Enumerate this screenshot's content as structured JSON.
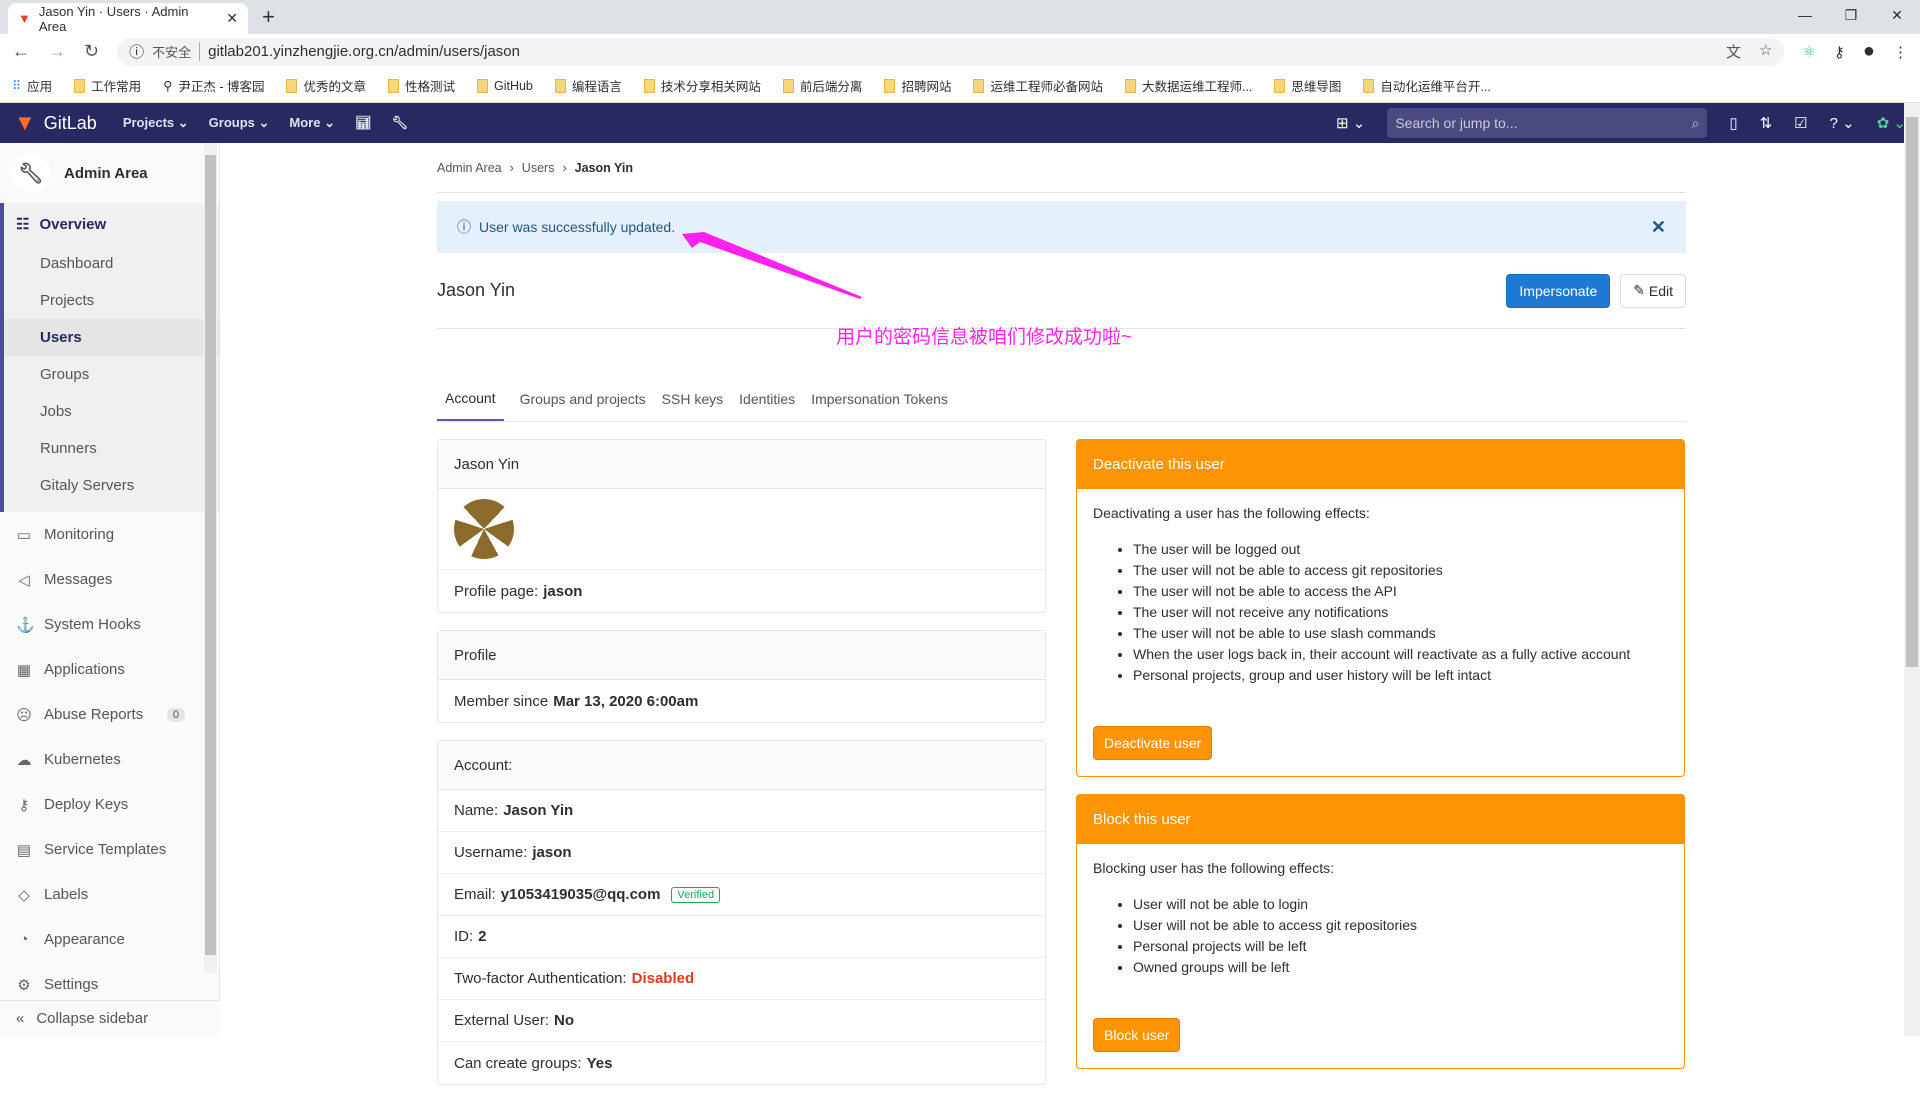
{
  "browser": {
    "tab_title": "Jason Yin · Users · Admin Area",
    "security": "不安全",
    "url": "gitlab201.yinzhengjie.org.cn/admin/users/jason",
    "bookmarks": [
      "应用",
      "工作常用",
      "尹正杰 - 博客园",
      "优秀的文章",
      "性格测试",
      "GitHub",
      "编程语言",
      "技术分享相关网站",
      "前后端分离",
      "招聘网站",
      "运维工程师必备网站",
      "大数据运维工程师...",
      "思维导图",
      "自动化运维平台开..."
    ]
  },
  "navbar": {
    "brand": "GitLab",
    "menus": [
      "Projects",
      "Groups",
      "More"
    ],
    "search_placeholder": "Search or jump to..."
  },
  "sidebar": {
    "title": "Admin Area",
    "overview": "Overview",
    "sub": [
      "Dashboard",
      "Projects",
      "Users",
      "Groups",
      "Jobs",
      "Runners",
      "Gitaly Servers"
    ],
    "items": [
      {
        "label": "Monitoring",
        "icon": "monitor-icon"
      },
      {
        "label": "Messages",
        "icon": "megaphone-icon"
      },
      {
        "label": "System Hooks",
        "icon": "hook-icon"
      },
      {
        "label": "Applications",
        "icon": "grid-icon"
      },
      {
        "label": "Abuse Reports",
        "icon": "sad-face-icon",
        "badge": "0"
      },
      {
        "label": "Kubernetes",
        "icon": "kubernetes-icon"
      },
      {
        "label": "Deploy Keys",
        "icon": "key-icon"
      },
      {
        "label": "Service Templates",
        "icon": "template-icon"
      },
      {
        "label": "Labels",
        "icon": "label-icon"
      },
      {
        "label": "Appearance",
        "icon": "palette-icon"
      },
      {
        "label": "Settings",
        "icon": "gear-icon"
      }
    ],
    "collapse": "Collapse sidebar"
  },
  "breadcrumb": [
    "Admin Area",
    "Users",
    "Jason Yin"
  ],
  "alert": "User was successfully updated.",
  "page_title": "Jason Yin",
  "buttons": {
    "impersonate": "Impersonate",
    "edit": "Edit"
  },
  "annotation": "用户的密码信息被咱们修改成功啦~",
  "tabs": [
    "Account",
    "Groups and projects",
    "SSH keys",
    "Identities",
    "Impersonation Tokens"
  ],
  "user_card": {
    "name": "Jason Yin",
    "profile_label": "Profile page:",
    "profile_value": "jason"
  },
  "profile_card": {
    "title": "Profile",
    "member_label": "Member since",
    "member_value": "Mar 13, 2020 6:00am"
  },
  "account_card": {
    "title": "Account:",
    "rows": [
      {
        "label": "Name:",
        "value": "Jason Yin"
      },
      {
        "label": "Username:",
        "value": "jason"
      },
      {
        "label": "Email:",
        "value": "y1053419035@qq.com",
        "badge": "Verified"
      },
      {
        "label": "ID:",
        "value": "2"
      },
      {
        "label": "Two-factor Authentication:",
        "value": "Disabled"
      },
      {
        "label": "External User:",
        "value": "No"
      },
      {
        "label": "Can create groups:",
        "value": "Yes"
      }
    ]
  },
  "deactivate": {
    "title": "Deactivate this user",
    "intro": "Deactivating a user has the following effects:",
    "effects": [
      "The user will be logged out",
      "The user will not be able to access git repositories",
      "The user will not be able to access the API",
      "The user will not receive any notifications",
      "The user will not be able to use slash commands",
      "When the user logs back in, their account will reactivate as a fully active account",
      "Personal projects, group and user history will be left intact"
    ],
    "button": "Deactivate user"
  },
  "block": {
    "title": "Block this user",
    "intro": "Blocking user has the following effects:",
    "effects": [
      "User will not be able to login",
      "User will not be able to access git repositories",
      "Personal projects will be left",
      "Owned groups will be left"
    ],
    "button": "Block user"
  },
  "colors": {
    "navbar": "#292961",
    "primary": "#1f78d1",
    "warning": "#fc9403",
    "danger": "#db3b21",
    "annotation": "#ff22ee"
  }
}
